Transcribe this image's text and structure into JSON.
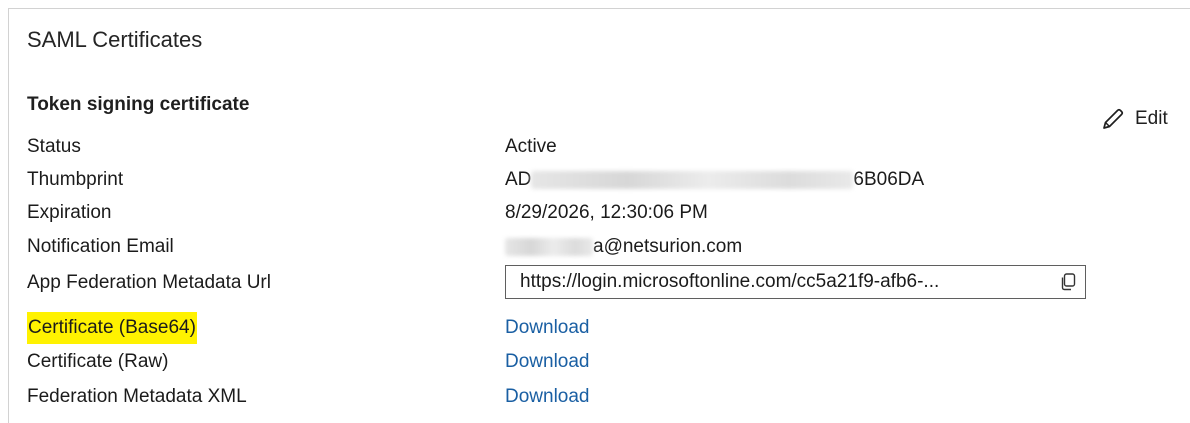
{
  "card": {
    "title": "SAML Certificates"
  },
  "token_signing": {
    "title": "Token signing certificate",
    "edit_label": "Edit",
    "rows": {
      "status": {
        "label": "Status",
        "value": "Active"
      },
      "thumbprint": {
        "label": "Thumbprint",
        "value_prefix": "AD",
        "value_suffix": "6B06DA"
      },
      "expiration": {
        "label": "Expiration",
        "value": "8/29/2026, 12:30:06 PM"
      },
      "notification_email": {
        "label": "Notification Email",
        "value_suffix": "a@netsurion.com"
      },
      "metadata_url": {
        "label": "App Federation Metadata Url",
        "value": "https://login.microsoftonline.com/cc5a21f9-afb6-..."
      },
      "cert_base64": {
        "label": "Certificate (Base64)",
        "link": "Download"
      },
      "cert_raw": {
        "label": "Certificate (Raw)",
        "link": "Download"
      },
      "federation_xml": {
        "label": "Federation Metadata XML",
        "link": "Download"
      }
    }
  },
  "icons": {
    "edit": "pencil-icon",
    "copy": "copy-icon"
  },
  "colors": {
    "link": "#1a5fa3",
    "highlight": "#fff200",
    "border": "#d2d2d2"
  }
}
